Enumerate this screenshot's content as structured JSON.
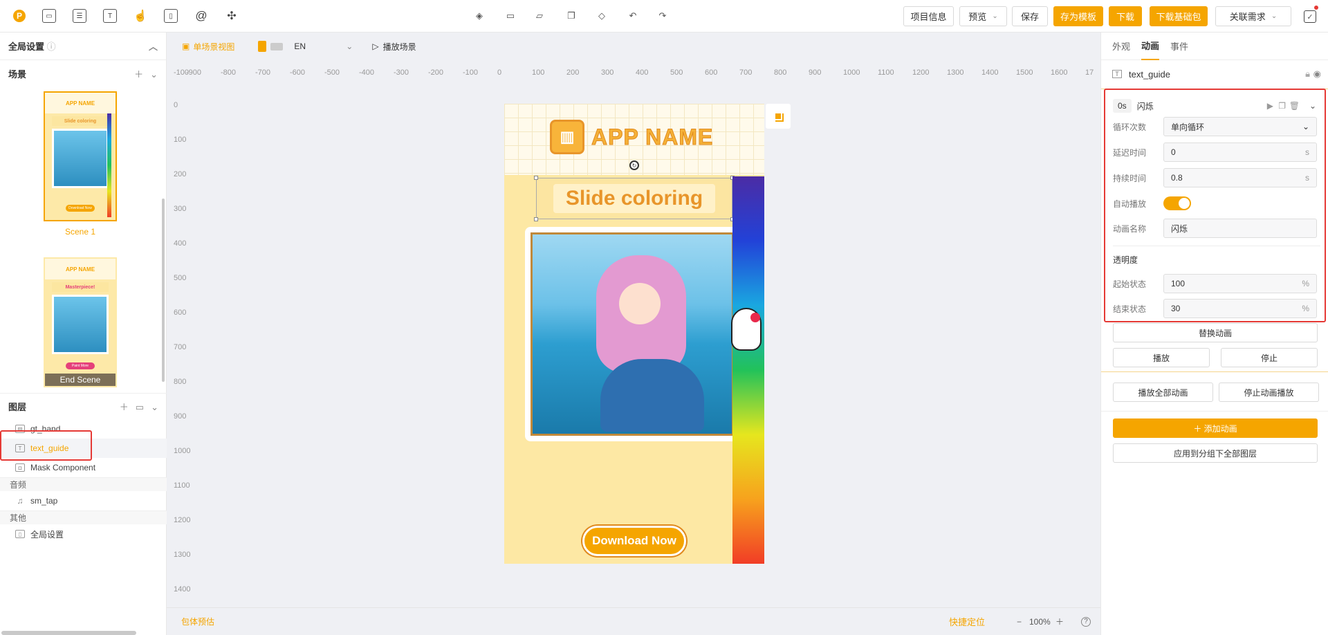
{
  "topbar": {
    "logo": "P",
    "tool_icons": [
      "inbox-icon",
      "layout-icon",
      "text-icon",
      "gesture-icon",
      "phone-icon",
      "mention-icon",
      "plugin-icon"
    ],
    "center_icons": [
      "layers-icon",
      "folder-icon",
      "folder-open-icon",
      "copy-icon",
      "tag-icon",
      "undo-icon",
      "redo-icon"
    ],
    "project_info": "项目信息",
    "preview": "预览",
    "save": "保存",
    "save_template": "存为模板",
    "download": "下载",
    "download_base": "下载基础包",
    "related": "关联需求"
  },
  "left": {
    "global_settings": "全局设置",
    "scenes_title": "场景",
    "scenes": [
      {
        "label": "Scene 1",
        "title": "APP NAME",
        "subtitle": "Slide coloring",
        "button": "Download Now"
      },
      {
        "label": "End Scene",
        "title": "APP NAME",
        "subtitle": "Masterpiece!",
        "button": "Paint More"
      }
    ],
    "layers_title": "图层",
    "layers": [
      {
        "name": "gt_hand",
        "icon": "image-icon"
      },
      {
        "name": "text_guide",
        "icon": "text-icon"
      },
      {
        "name": "Mask Component",
        "icon": "mask-icon"
      }
    ],
    "audio_title": "音频",
    "audio": [
      {
        "name": "sm_tap",
        "icon": "music-icon"
      }
    ],
    "other_title": "其他",
    "other": [
      {
        "name": "全局设置",
        "icon": "phone-icon"
      }
    ]
  },
  "canvas": {
    "view_mode": "单场景视图",
    "language": "EN",
    "play_scene": "播放场景",
    "ruler_h": [
      "-100",
      "-900",
      "-800",
      "-700",
      "-600",
      "-500",
      "-400",
      "-300",
      "-200",
      "-100",
      "0",
      "100",
      "200",
      "300",
      "400",
      "500",
      "600",
      "700",
      "800",
      "900",
      "1000",
      "1100",
      "1200",
      "1300",
      "1400",
      "1500",
      "1600",
      "17"
    ],
    "ruler_v": [
      "0",
      "100",
      "200",
      "300",
      "400",
      "500",
      "600",
      "700",
      "800",
      "900",
      "1000",
      "1100",
      "1200",
      "1300",
      "1400"
    ],
    "app_name": "APP NAME",
    "slide_text": "Slide coloring",
    "download_now": "Download Now",
    "package_estimate": "包体预估",
    "quick_locate": "快捷定位",
    "zoom": "100%",
    "help": "?"
  },
  "right": {
    "tabs": [
      "外观",
      "动画",
      "事件"
    ],
    "active_tab": "动画",
    "object_name": "text_guide",
    "anim": {
      "time": "0s",
      "name_head": "闪烁",
      "loop_label": "循环次数",
      "loop_value": "单向循环",
      "delay_label": "延迟时间",
      "delay_value": "0",
      "delay_unit": "s",
      "duration_label": "持续时间",
      "duration_value": "0.8",
      "duration_unit": "s",
      "autoplay_label": "自动播放",
      "anim_name_label": "动画名称",
      "anim_name_value": "闪烁",
      "opacity_title": "透明度",
      "start_label": "起始状态",
      "start_value": "100",
      "start_unit": "%",
      "end_label": "结束状态",
      "end_value": "30",
      "end_unit": "%"
    },
    "replace_anim": "替换动画",
    "play": "播放",
    "stop": "停止",
    "play_all": "播放全部动画",
    "stop_all": "停止动画播放",
    "add_anim": "＋ 添加动画",
    "apply_group": "应用到分组下全部图层"
  },
  "colors": {
    "accent": "#f5a500",
    "highlight": "#e53935"
  }
}
